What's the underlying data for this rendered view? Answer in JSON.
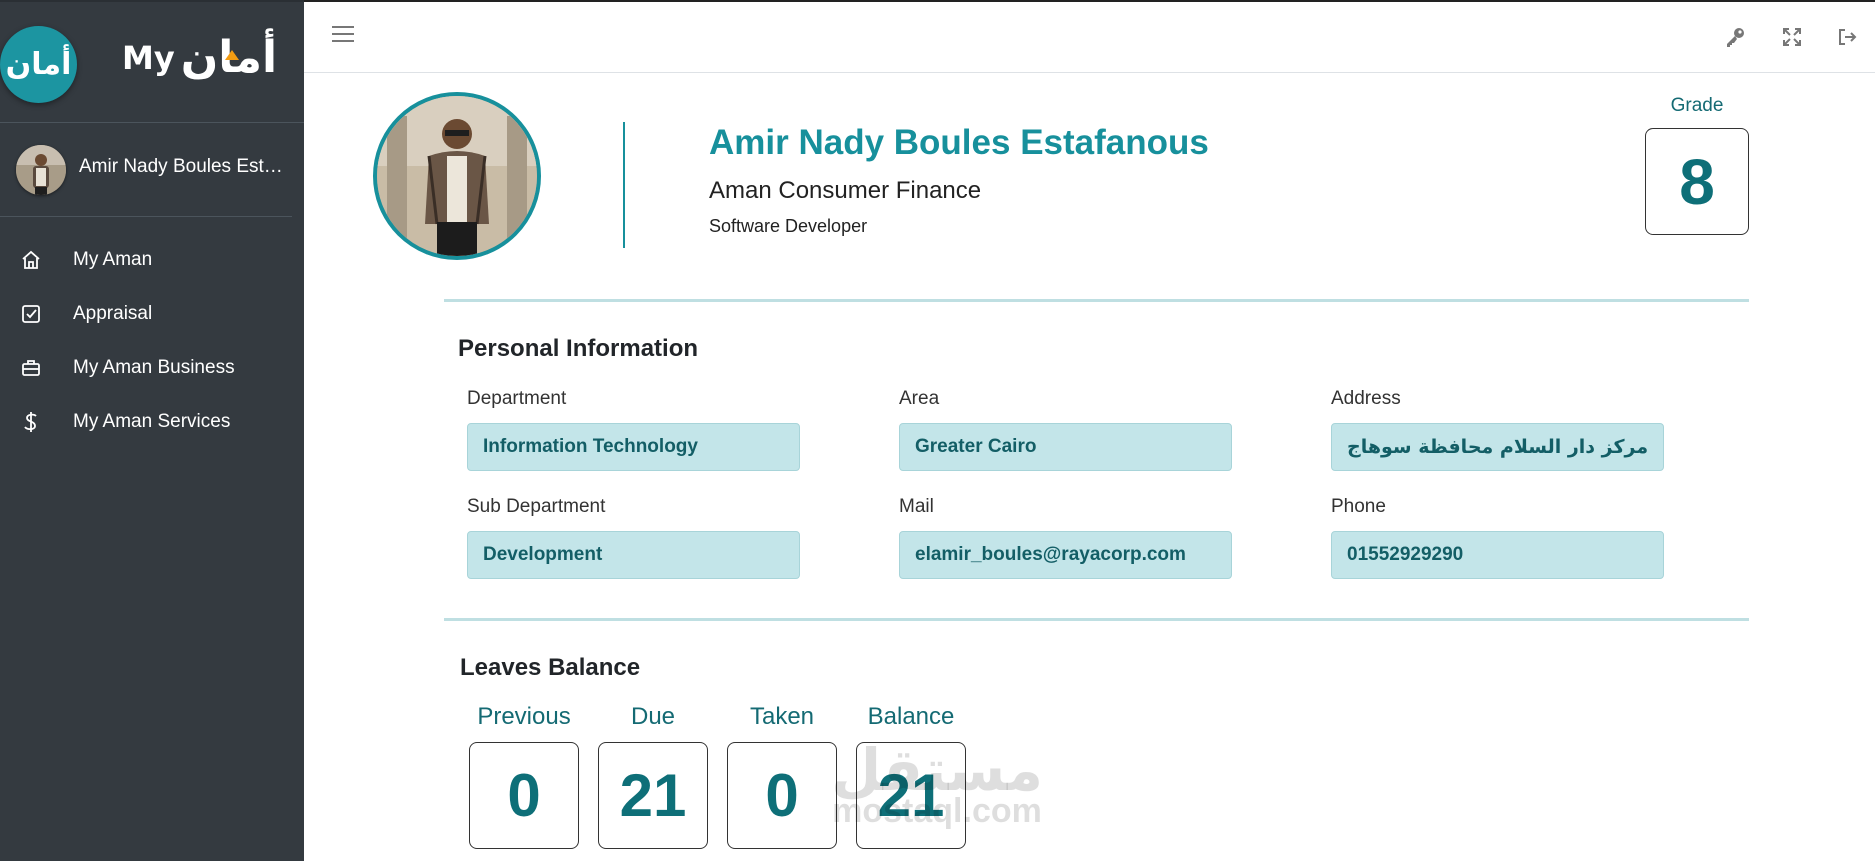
{
  "sidebar": {
    "brand_circle_text": "أمان",
    "brand_my": "My",
    "brand_arabic": "أمان",
    "user_name": "Amir Nady Boules Estafanous",
    "items": [
      {
        "label": "My Aman",
        "icon": "home-icon"
      },
      {
        "label": "Appraisal",
        "icon": "check-square-icon"
      },
      {
        "label": "My Aman Business",
        "icon": "briefcase-icon"
      },
      {
        "label": "My Aman Services",
        "icon": "dollar-icon"
      }
    ]
  },
  "header": {
    "icons": [
      "menu-icon",
      "key-icon",
      "fullscreen-icon",
      "logout-icon"
    ]
  },
  "profile": {
    "name": "Amir Nady Boules Estafanous",
    "company": "Aman Consumer Finance",
    "title": "Software Developer",
    "grade_label": "Grade",
    "grade_value": "8"
  },
  "personal_info": {
    "title": "Personal Information",
    "fields": [
      {
        "label": "Department",
        "value": "Information Technology"
      },
      {
        "label": "Area",
        "value": "Greater Cairo"
      },
      {
        "label": "Address",
        "value": "مركز دار السلام محافظة سوهاج"
      },
      {
        "label": "Sub Department",
        "value": "Development"
      },
      {
        "label": "Mail",
        "value": "elamir_boules@rayacorp.com"
      },
      {
        "label": "Phone",
        "value": "01552929290"
      }
    ]
  },
  "leaves": {
    "title": "Leaves Balance",
    "items": [
      {
        "label": "Previous",
        "value": "0"
      },
      {
        "label": "Due",
        "value": "21"
      },
      {
        "label": "Taken",
        "value": "0"
      },
      {
        "label": "Balance",
        "value": "21"
      }
    ]
  },
  "watermark": {
    "arabic": "مستقل",
    "english": "mostaql.com"
  },
  "colors": {
    "sidebar": "#343a40",
    "accent": "#17909c",
    "field_bg": "#c3e5e9",
    "brand_orange": "#f39c12"
  }
}
